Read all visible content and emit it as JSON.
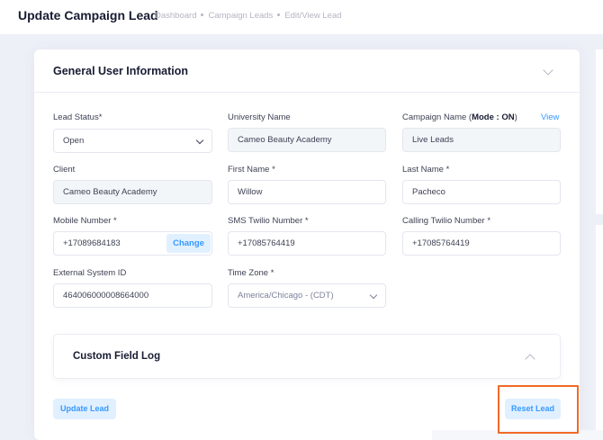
{
  "header": {
    "title": "Update Campaign Lead",
    "breadcrumb": [
      "Dashboard",
      "Campaign Leads",
      "Edit/View Lead"
    ]
  },
  "section": {
    "title": "General User Information"
  },
  "fields": {
    "lead_status": {
      "label": "Lead Status*",
      "value": "Open"
    },
    "university_name": {
      "label": "University Name",
      "value": "Cameo Beauty Academy"
    },
    "campaign_name": {
      "label_prefix": "Campaign Name (",
      "label_mode": "Mode : ON",
      "label_suffix": ")",
      "link": "View",
      "value": "Live Leads"
    },
    "client": {
      "label": "Client",
      "value": "Cameo Beauty Academy"
    },
    "first_name": {
      "label": "First Name *",
      "value": "Willow"
    },
    "last_name": {
      "label": "Last Name *",
      "value": "Pacheco"
    },
    "mobile_number": {
      "label": "Mobile Number *",
      "value": "+17089684183",
      "action": "Change"
    },
    "sms_twilio_number": {
      "label": "SMS Twilio Number *",
      "value": "+17085764419"
    },
    "calling_twilio_number": {
      "label": "Calling Twilio Number *",
      "value": "+17085764419"
    },
    "external_system_id": {
      "label": "External System ID",
      "value": "464006000008664000"
    },
    "time_zone": {
      "label": "Time Zone *",
      "value": "America/Chicago - (CDT)"
    }
  },
  "custom_field_log": {
    "title": "Custom Field Log"
  },
  "actions": {
    "update": "Update Lead",
    "reset": "Reset Lead"
  },
  "colors": {
    "accent": "#3699ff",
    "accent_light": "#e1f0ff",
    "highlight": "#f06a27",
    "background": "#eef0f8"
  }
}
